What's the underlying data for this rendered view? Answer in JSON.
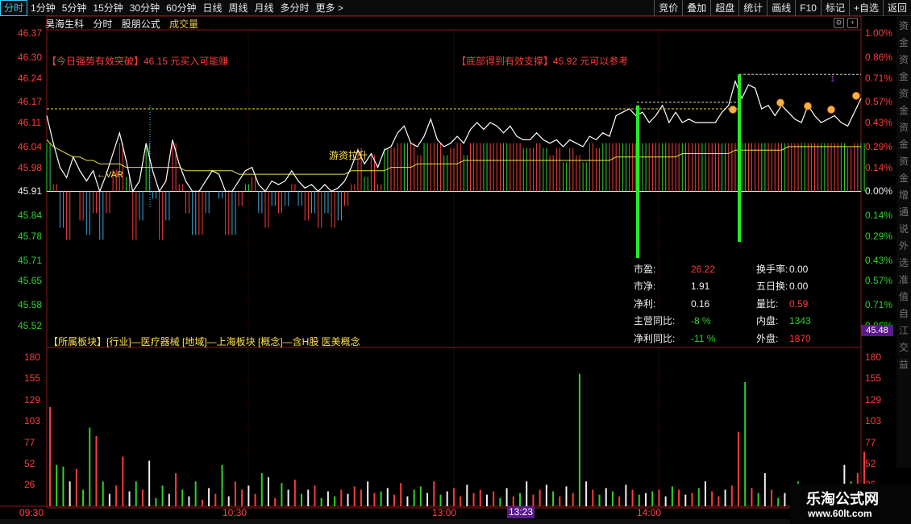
{
  "toolbar": {
    "periods": [
      "分时",
      "1分钟",
      "5分钟",
      "15分钟",
      "30分钟",
      "60分钟",
      "日线",
      "周线",
      "月线",
      "多分时",
      "更多 >"
    ],
    "tools": [
      "竞价",
      "叠加",
      "超盘",
      "统计",
      "画线",
      "F10",
      "标记",
      "+自选",
      "返回"
    ]
  },
  "header": {
    "stock_name": "昊海生科",
    "mode": "分时",
    "formula": "股朋公式",
    "volume_label": "成交量"
  },
  "price_axis": {
    "left": [
      "46.37",
      "46.30",
      "46.24",
      "46.17",
      "46.11",
      "46.04",
      "45.98",
      "45.91",
      "45.84",
      "45.78",
      "45.71",
      "45.65",
      "45.58",
      "45.52"
    ],
    "right": [
      "1.00%",
      "0.86%",
      "0.71%",
      "0.57%",
      "0.43%",
      "0.29%",
      "0.14%",
      "0.00%",
      "0.14%",
      "0.29%",
      "0.43%",
      "0.57%",
      "0.71%",
      "0.86%"
    ]
  },
  "volume_axis": [
    "180",
    "155",
    "129",
    "103",
    "77",
    "52",
    "26"
  ],
  "annotations": {
    "left_signal": "【今日强势有效突破】46.15 元买入可能赚",
    "right_signal": "【底部得到有效支撑】45.92 元可以参考",
    "var_label": "←VAR",
    "funds_label": "游资拉升",
    "marker": "1"
  },
  "fundamentals": {
    "pe_label": "市盈:",
    "pe": "26.22",
    "turnover_label": "换手率:",
    "turnover": "0.00",
    "pb_label": "市净:",
    "pb": "1.91",
    "five_day_label": "五日换:",
    "five_day": "0.00",
    "profit_label": "净利:",
    "profit": "0.16",
    "vol_ratio_label": "量比:",
    "vol_ratio": "0.59",
    "rev_yoy_label": "主营同比:",
    "rev_yoy": "-8 %",
    "inner_label": "内盘:",
    "inner": "1343",
    "profit_yoy_label": "净利同比:",
    "profit_yoy": "-11 %",
    "outer_label": "外盘:",
    "outer": "1870"
  },
  "sector": "【所属板块】[行业]—医疗器械 [地域]—上海板块 [概念]—含H股 医美概念",
  "side_price": "45.48",
  "time_axis": [
    "09:30",
    "10:30",
    "13:00",
    "14:00"
  ],
  "cursor_time": "13:23",
  "watermark": {
    "title": "乐淘公式网",
    "url": "www.60lt.com"
  },
  "right_strip": [
    "资",
    "金",
    "资",
    "金",
    "资",
    "金",
    "资",
    "金",
    "资",
    "金",
    "增",
    "通",
    "说",
    "外",
    "选",
    "准",
    "值",
    "自",
    "江",
    "交",
    "益"
  ],
  "chart_data": {
    "type": "line",
    "price_range": [
      45.52,
      46.37
    ],
    "prev_close": 45.91,
    "price_ticks": [
      46.37,
      46.3,
      46.24,
      46.17,
      46.11,
      46.04,
      45.98,
      45.91,
      45.84,
      45.78,
      45.71,
      45.65,
      45.58,
      45.52
    ],
    "reference_levels": [
      46.15,
      46.25
    ],
    "price": [
      46.13,
      46.05,
      45.98,
      45.95,
      46.01,
      45.97,
      45.94,
      45.97,
      45.91,
      45.96,
      46.02,
      46.08,
      46.0,
      45.91,
      45.94,
      46.05,
      45.97,
      45.91,
      45.94,
      46.06,
      45.99,
      45.94,
      45.91,
      45.91,
      45.94,
      45.97,
      45.96,
      45.91,
      45.91,
      45.94,
      45.97,
      45.98,
      45.93,
      45.91,
      45.94,
      45.93,
      45.94,
      45.97,
      45.94,
      45.92,
      45.93,
      45.91,
      45.93,
      45.91,
      45.92,
      45.94,
      45.98,
      46.03,
      45.99,
      46.02,
      45.98,
      46.03,
      46.04,
      46.08,
      46.1,
      46.05,
      46.04,
      46.07,
      46.12,
      46.06,
      46.04,
      46.05,
      46.07,
      46.05,
      46.09,
      46.11,
      46.09,
      46.11,
      46.1,
      46.08,
      46.1,
      46.07,
      46.06,
      46.06,
      46.08,
      46.06,
      46.05,
      46.06,
      46.04,
      46.06,
      46.05,
      46.04,
      46.07,
      46.06,
      46.08,
      46.07,
      46.13,
      46.14,
      46.15,
      46.13,
      46.14,
      46.11,
      46.13,
      46.16,
      46.11,
      46.14,
      46.11,
      46.12,
      46.11,
      46.11,
      46.11,
      46.11,
      46.14,
      46.16,
      46.23,
      46.18,
      46.22,
      46.21,
      46.15,
      46.16,
      46.13,
      46.16,
      46.14,
      46.12,
      46.11,
      46.16,
      46.13,
      46.11,
      46.12,
      46.13,
      46.11,
      46.1,
      46.14,
      46.18
    ],
    "avg_price": [
      46.06,
      46.04,
      46.03,
      46.02,
      46.01,
      46.01,
      46.0,
      46.0,
      45.99,
      45.99,
      45.99,
      45.99,
      45.98,
      45.98,
      45.98,
      45.98,
      45.98,
      45.98,
      45.98,
      45.98,
      45.98,
      45.97,
      45.97,
      45.97,
      45.97,
      45.97,
      45.97,
      45.97,
      45.97,
      45.96,
      45.96,
      45.96,
      45.96,
      45.96,
      45.96,
      45.96,
      45.96,
      45.96,
      45.96,
      45.96,
      45.96,
      45.96,
      45.96,
      45.96,
      45.96,
      45.96,
      45.97,
      45.97,
      45.97,
      45.97,
      45.97,
      45.97,
      45.98,
      45.98,
      45.98,
      45.98,
      45.99,
      45.99,
      45.99,
      45.99,
      45.99,
      45.99,
      45.99,
      46.0,
      46.0,
      46.0,
      46.0,
      46.0,
      46.0,
      46.0,
      46.0,
      46.0,
      46.0,
      46.0,
      46.0,
      46.0,
      46.0,
      46.0,
      46.0,
      46.0,
      46.0,
      46.0,
      46.0,
      46.0,
      46.0,
      46.0,
      46.01,
      46.01,
      46.01,
      46.01,
      46.01,
      46.01,
      46.01,
      46.01,
      46.01,
      46.01,
      46.02,
      46.02,
      46.02,
      46.02,
      46.02,
      46.02,
      46.02,
      46.02,
      46.03,
      46.03,
      46.03,
      46.03,
      46.03,
      46.03,
      46.03,
      46.03,
      46.04,
      46.04,
      46.04,
      46.04,
      46.04,
      46.04,
      46.04,
      46.04,
      46.04,
      46.04,
      46.04,
      46.04
    ],
    "volume_ticks": [
      180,
      155,
      129,
      103,
      77,
      52,
      26
    ],
    "volume": [
      120,
      50,
      48,
      30,
      45,
      20,
      95,
      85,
      30,
      15,
      25,
      60,
      18,
      30,
      20,
      55,
      10,
      25,
      15,
      40,
      20,
      12,
      30,
      8,
      22,
      15,
      50,
      12,
      30,
      20,
      25,
      15,
      40,
      35,
      10,
      28,
      20,
      32,
      15,
      20,
      25,
      10,
      18,
      12,
      20,
      15,
      24,
      20,
      30,
      16,
      18,
      22,
      14,
      28,
      12,
      20,
      24,
      16,
      30,
      14,
      18,
      22,
      12,
      26,
      16,
      20,
      14,
      18,
      10,
      22,
      12,
      16,
      30,
      14,
      20,
      26,
      18,
      12,
      24,
      16,
      160,
      30,
      20,
      14,
      22,
      18,
      12,
      26,
      20,
      14,
      16,
      18,
      20,
      12,
      24,
      20,
      14,
      16,
      22,
      30,
      18,
      12,
      20,
      25,
      90,
      150,
      22,
      16,
      40,
      20,
      10,
      16,
      22,
      30,
      12,
      10,
      18,
      26,
      14,
      20,
      50,
      30,
      40,
      66
    ]
  }
}
